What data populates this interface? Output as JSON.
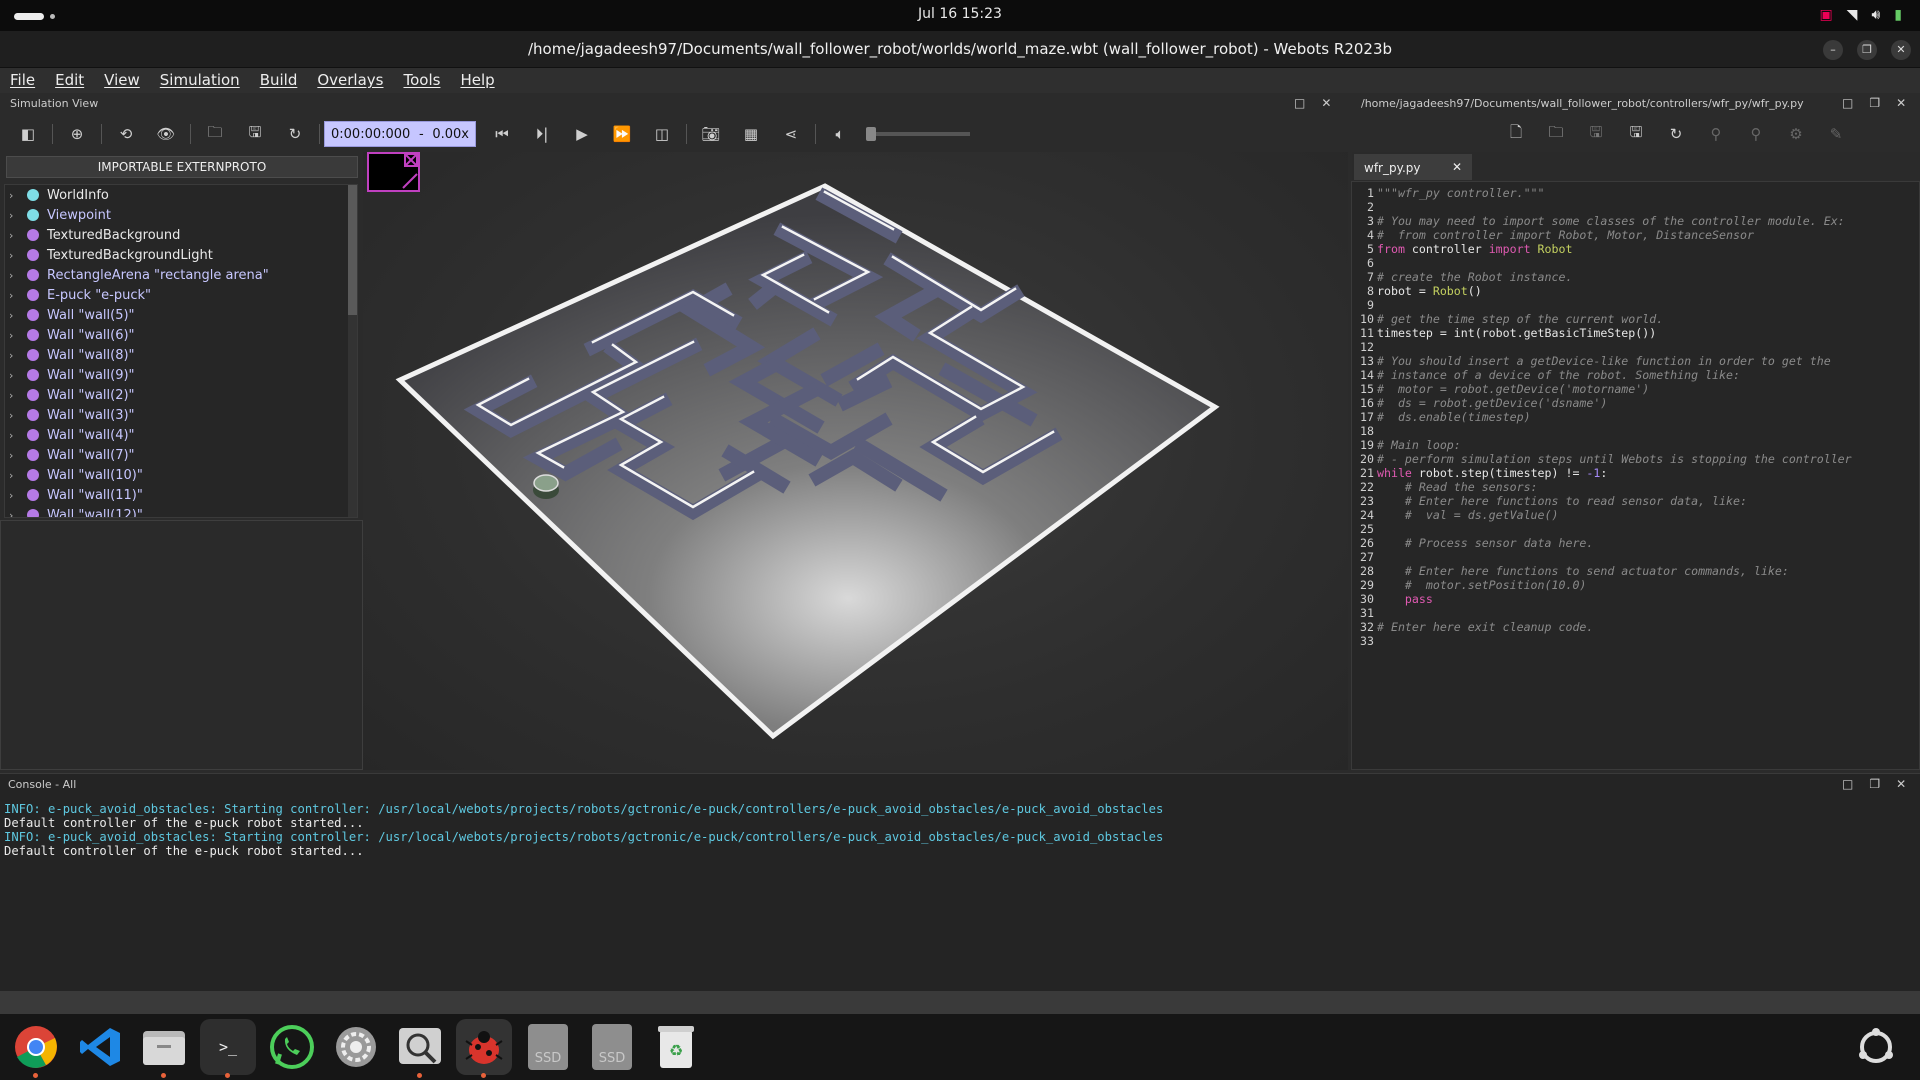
{
  "topbar": {
    "clock": "Jul 16  15:23"
  },
  "window": {
    "title": "/home/jagadeesh97/Documents/wall_follower_robot/worlds/world_maze.wbt (wall_follower_robot) - Webots R2023b"
  },
  "menu": [
    "File",
    "Edit",
    "View",
    "Simulation",
    "Build",
    "Overlays",
    "Tools",
    "Help"
  ],
  "sim_view": {
    "title": "Simulation View",
    "time": "0:00:00:000",
    "dash": "-",
    "speed": "0.00x"
  },
  "scene_tree": {
    "header": "IMPORTABLE EXTERNPROTO",
    "items": [
      {
        "label": "WorldInfo",
        "color": "#7fdde6"
      },
      {
        "label": "Viewpoint",
        "color": "#7fdde6",
        "link": true
      },
      {
        "label": "TexturedBackground",
        "color": "#b57ae6"
      },
      {
        "label": "TexturedBackgroundLight",
        "color": "#b57ae6"
      },
      {
        "label": "RectangleArena \"rectangle arena\"",
        "color": "#b57ae6",
        "link": true
      },
      {
        "label": "E-puck \"e-puck\"",
        "color": "#b57ae6",
        "link": true
      },
      {
        "label": "Wall \"wall(5)\"",
        "color": "#b57ae6",
        "link": true
      },
      {
        "label": "Wall \"wall(6)\"",
        "color": "#b57ae6",
        "link": true
      },
      {
        "label": "Wall \"wall(8)\"",
        "color": "#b57ae6",
        "link": true
      },
      {
        "label": "Wall \"wall(9)\"",
        "color": "#b57ae6",
        "link": true
      },
      {
        "label": "Wall \"wall(2)\"",
        "color": "#b57ae6",
        "link": true
      },
      {
        "label": "Wall \"wall(3)\"",
        "color": "#b57ae6",
        "link": true
      },
      {
        "label": "Wall \"wall(4)\"",
        "color": "#b57ae6",
        "link": true
      },
      {
        "label": "Wall \"wall(7)\"",
        "color": "#b57ae6",
        "link": true
      },
      {
        "label": "Wall \"wall(10)\"",
        "color": "#b57ae6",
        "link": true
      },
      {
        "label": "Wall \"wall(11)\"",
        "color": "#b57ae6",
        "link": true
      },
      {
        "label": "Wall \"wall(12)\"",
        "color": "#b57ae6",
        "link": true
      }
    ]
  },
  "editor": {
    "path": "/home/jagadeesh97/Documents/wall_follower_robot/controllers/wfr_py/wfr_py.py",
    "tab": "wfr_py.py",
    "lines": [
      [
        [
          "cm",
          "\"\"\"wfr_py controller.\"\"\""
        ]
      ],
      [],
      [
        [
          "cm",
          "# You may need to import some classes of the controller module. Ex:"
        ]
      ],
      [
        [
          "cm",
          "#  from controller import Robot, Motor, DistanceSensor"
        ]
      ],
      [
        [
          "kw",
          "from"
        ],
        [
          "t",
          " controller "
        ],
        [
          "kw",
          "import"
        ],
        [
          "fn",
          " Robot"
        ]
      ],
      [],
      [
        [
          "cm",
          "# create the Robot instance."
        ]
      ],
      [
        [
          "t",
          "robot = "
        ],
        [
          "fn",
          "Robot"
        ],
        [
          "t",
          "()"
        ]
      ],
      [],
      [
        [
          "cm",
          "# get the time step of the current world."
        ]
      ],
      [
        [
          "t",
          "timestep = int(robot.getBasicTimeStep())"
        ]
      ],
      [],
      [
        [
          "cm",
          "# You should insert a getDevice-like function in order to get the"
        ]
      ],
      [
        [
          "cm",
          "# instance of a device of the robot. Something like:"
        ]
      ],
      [
        [
          "cm",
          "#  motor = robot.getDevice('motorname')"
        ]
      ],
      [
        [
          "cm",
          "#  ds = robot.getDevice('dsname')"
        ]
      ],
      [
        [
          "cm",
          "#  ds.enable(timestep)"
        ]
      ],
      [],
      [
        [
          "cm",
          "# Main loop:"
        ]
      ],
      [
        [
          "cm",
          "# - perform simulation steps until Webots is stopping the controller"
        ]
      ],
      [
        [
          "kw",
          "while"
        ],
        [
          "t",
          " robot.step(timestep) != "
        ],
        [
          "num",
          "-1"
        ],
        [
          "t",
          ":"
        ]
      ],
      [
        [
          "t",
          "    "
        ],
        [
          "cm",
          "# Read the sensors:"
        ]
      ],
      [
        [
          "t",
          "    "
        ],
        [
          "cm",
          "# Enter here functions to read sensor data, like:"
        ]
      ],
      [
        [
          "t",
          "    "
        ],
        [
          "cm",
          "#  val = ds.getValue()"
        ]
      ],
      [],
      [
        [
          "t",
          "    "
        ],
        [
          "cm",
          "# Process sensor data here."
        ]
      ],
      [],
      [
        [
          "t",
          "    "
        ],
        [
          "cm",
          "# Enter here functions to send actuator commands, like:"
        ]
      ],
      [
        [
          "t",
          "    "
        ],
        [
          "cm",
          "#  motor.setPosition(10.0)"
        ]
      ],
      [
        [
          "t",
          "    "
        ],
        [
          "kw",
          "pass"
        ]
      ],
      [],
      [
        [
          "cm",
          "# Enter here exit cleanup code."
        ]
      ],
      []
    ]
  },
  "console": {
    "title": "Console - All",
    "lines": [
      {
        "type": "info",
        "text": "INFO: e-puck_avoid_obstacles: Starting controller: /usr/local/webots/projects/robots/gctronic/e-puck/controllers/e-puck_avoid_obstacles/e-puck_avoid_obstacles"
      },
      {
        "type": "plain",
        "text": "Default controller of the e-puck robot started..."
      },
      {
        "type": "info",
        "text": "INFO: e-puck_avoid_obstacles: Starting controller: /usr/local/webots/projects/robots/gctronic/e-puck/controllers/e-puck_avoid_obstacles/e-puck_avoid_obstacles"
      },
      {
        "type": "plain",
        "text": "Default controller of the e-puck robot started..."
      }
    ]
  },
  "dock": {
    "items": [
      {
        "name": "chrome-icon",
        "running": true
      },
      {
        "name": "vscode-icon",
        "running": false
      },
      {
        "name": "files-icon",
        "running": true
      },
      {
        "name": "terminal-icon",
        "running": true
      },
      {
        "name": "whatsapp-icon",
        "running": false
      },
      {
        "name": "settings-icon",
        "running": false
      },
      {
        "name": "image-viewer-icon",
        "running": true
      },
      {
        "name": "webots-icon",
        "running": true
      },
      {
        "name": "ssd-drive-icon",
        "running": false,
        "label": "SSD"
      },
      {
        "name": "ssd-drive-icon",
        "running": false,
        "label": "SSD"
      },
      {
        "name": "trash-icon",
        "running": false
      }
    ]
  }
}
